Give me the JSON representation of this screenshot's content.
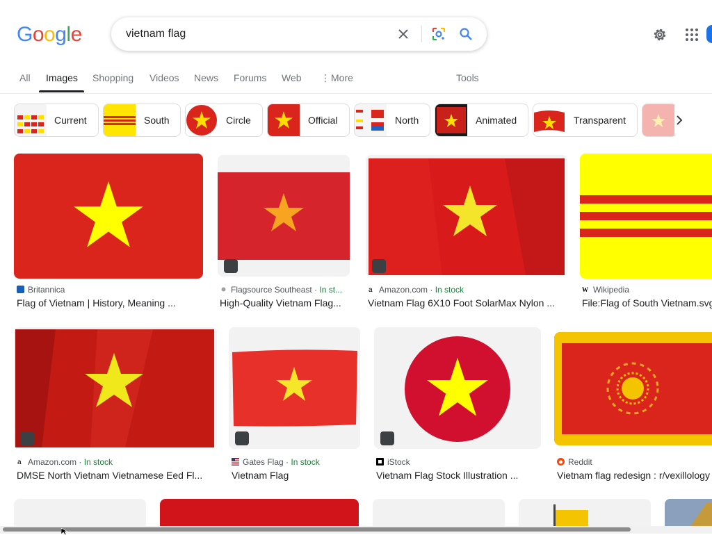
{
  "logo": {
    "letters": [
      "G",
      "o",
      "o",
      "g",
      "l",
      "e"
    ]
  },
  "search": {
    "query": "vietnam flag"
  },
  "tabs": [
    {
      "label": "All"
    },
    {
      "label": "Images"
    },
    {
      "label": "Shopping"
    },
    {
      "label": "Videos"
    },
    {
      "label": "News"
    },
    {
      "label": "Forums"
    },
    {
      "label": "Web"
    },
    {
      "label": "More"
    },
    {
      "label": "Tools"
    }
  ],
  "chips": [
    {
      "label": "Current"
    },
    {
      "label": "South"
    },
    {
      "label": "Circle"
    },
    {
      "label": "Official"
    },
    {
      "label": "North"
    },
    {
      "label": "Animated"
    },
    {
      "label": "Transparent"
    }
  ],
  "results": [
    {
      "source": "Britannica",
      "stock": "",
      "title": "Flag of Vietnam | History, Meaning ..."
    },
    {
      "source": "Flagsource Southeast",
      "stock": "In st...",
      "title": "High-Quality Vietnam Flag..."
    },
    {
      "source": "Amazon.com",
      "stock": "In stock",
      "title": "Vietnam Flag 6X10 Foot SolarMax Nylon ..."
    },
    {
      "source": "Wikipedia",
      "stock": "",
      "title": "File:Flag of South Vietnam.svg"
    },
    {
      "source": "Amazon.com",
      "stock": "In stock",
      "title": "DMSE North Vietnam Vietnamese Eed Fl..."
    },
    {
      "source": "Gates Flag",
      "stock": "In stock",
      "title": "Vietnam Flag"
    },
    {
      "source": "iStock",
      "stock": "",
      "title": "Vietnam Flag Stock Illustration ..."
    },
    {
      "source": "Reddit",
      "stock": "",
      "title": "Vietnam flag redesign : r/vexillology"
    }
  ],
  "colors": {
    "flag_red": "#da251d",
    "flag_yellow": "#ffff00",
    "in_stock": "#188038"
  }
}
